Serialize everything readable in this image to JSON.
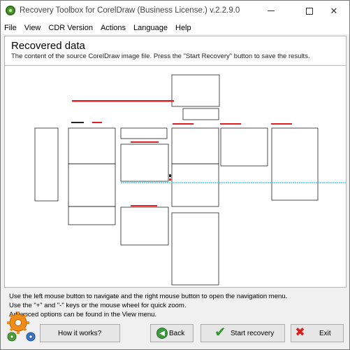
{
  "window": {
    "title": "Recovery Toolbox for CorelDraw (Business License.) v.2.2.9.0"
  },
  "menu": {
    "items": [
      "File",
      "View",
      "CDR Version",
      "Actions",
      "Language",
      "Help"
    ]
  },
  "header": {
    "title": "Recovered data",
    "subtitle": "The content of the source CorelDraw image file. Press the \"Start Recovery\" button to save the results."
  },
  "info": {
    "line1": "Use the left mouse button to navigate and the right mouse button to open the navigation menu.",
    "line2": "Use the \"+\" and \"-\" keys or the mouse wheel for quick zoom.",
    "line3": "Advanced options can be found in the View menu."
  },
  "buttons": {
    "how": "How it works?",
    "back": "Back",
    "start": "Start recovery",
    "exit": "Exit"
  },
  "icons": {
    "app": "app-logo-icon",
    "gears": "gears-icon",
    "back": "arrow-left-icon",
    "start": "checkmark-icon",
    "exit": "close-icon"
  },
  "colors": {
    "preview_text": "#e02020",
    "preview_line": "#3fd0e0"
  }
}
